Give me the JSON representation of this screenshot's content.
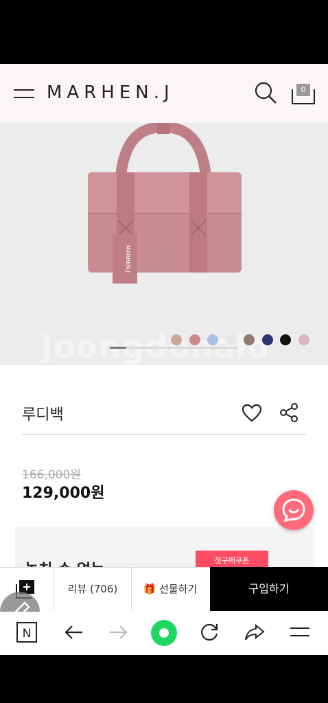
{
  "header": {
    "logo": "MARHEN.J",
    "cart_count": "0"
  },
  "hero": {
    "strap_print": "MARHEN.J",
    "watermark": "Joongdonald",
    "progress_fraction": 0.13,
    "swatches": [
      "#c9a898",
      "#c98a90",
      "#a8c0e8",
      "#e6e6e2",
      "#8f7b71",
      "#2e3470",
      "#111111",
      "#d8b6c2"
    ]
  },
  "product": {
    "name": "루디백",
    "original_price": "166,000원",
    "price": "129,000원"
  },
  "coupon": {
    "heading": "놓치 수 없는",
    "button": "첫구매쿠폰"
  },
  "actions": {
    "review": "리뷰 (706)",
    "gift": "선물하기",
    "buy": "구입하기"
  },
  "colors": {
    "header_bg": "#fbf4f9",
    "buy_button": "#000000",
    "chat_fab": "#ff6b7a",
    "coupon_button": "#ff4c63",
    "browser_home": "#1ed760"
  }
}
